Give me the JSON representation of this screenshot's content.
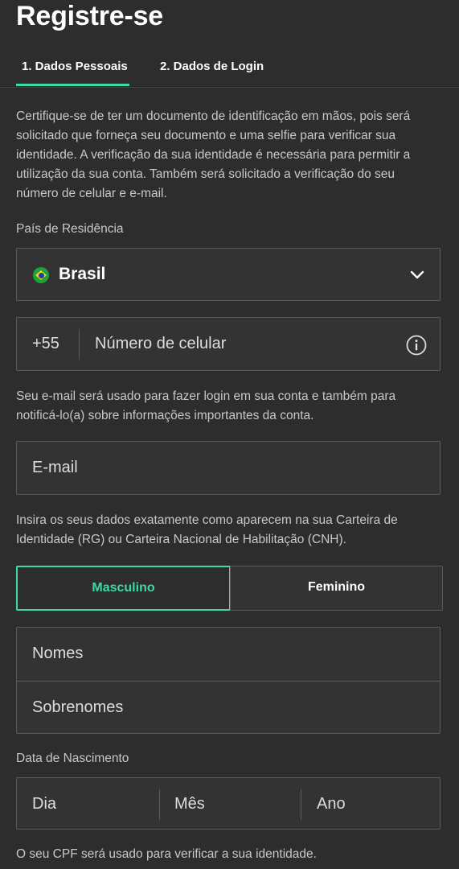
{
  "page": {
    "title": "Registre-se"
  },
  "tabs": [
    {
      "label": "1.  Dados Pessoais",
      "active": true
    },
    {
      "label": "2.  Dados de Login",
      "active": false
    }
  ],
  "intro": "Certifique-se de ter um documento de identificação em mãos, pois será solicitado que forneça seu documento e uma selfie para verificar sua identidade. A verificação da sua identidade é necessária para permitir a utilização da sua conta. Também será solicitado a verificação do seu número de celular e e-mail.",
  "country": {
    "label": "País de Residência",
    "value": "Brasil"
  },
  "phone": {
    "prefix": "+55",
    "placeholder": "Número de celular"
  },
  "email_note": "Seu e-mail será usado para fazer login em sua conta e também para notificá-lo(a) sobre informações importantes da conta.",
  "email": {
    "placeholder": "E-mail"
  },
  "id_note": "Insira os seus dados exatamente como aparecem na sua Carteira de Identidade (RG) ou Carteira Nacional de Habilitação (CNH).",
  "gender": {
    "options": [
      "Masculino",
      "Feminino"
    ],
    "selected": "Masculino"
  },
  "names": {
    "first_placeholder": "Nomes",
    "last_placeholder": "Sobrenomes"
  },
  "dob": {
    "label": "Data de Nascimento",
    "day": "Dia",
    "month": "Mês",
    "year": "Ano"
  },
  "cpf_note": "O seu CPF será usado para verificar a sua identidade.",
  "colors": {
    "accent": "#3fd8a6",
    "background": "#2d2d2d",
    "field_bg": "#333333",
    "border": "#5a5a5a"
  }
}
